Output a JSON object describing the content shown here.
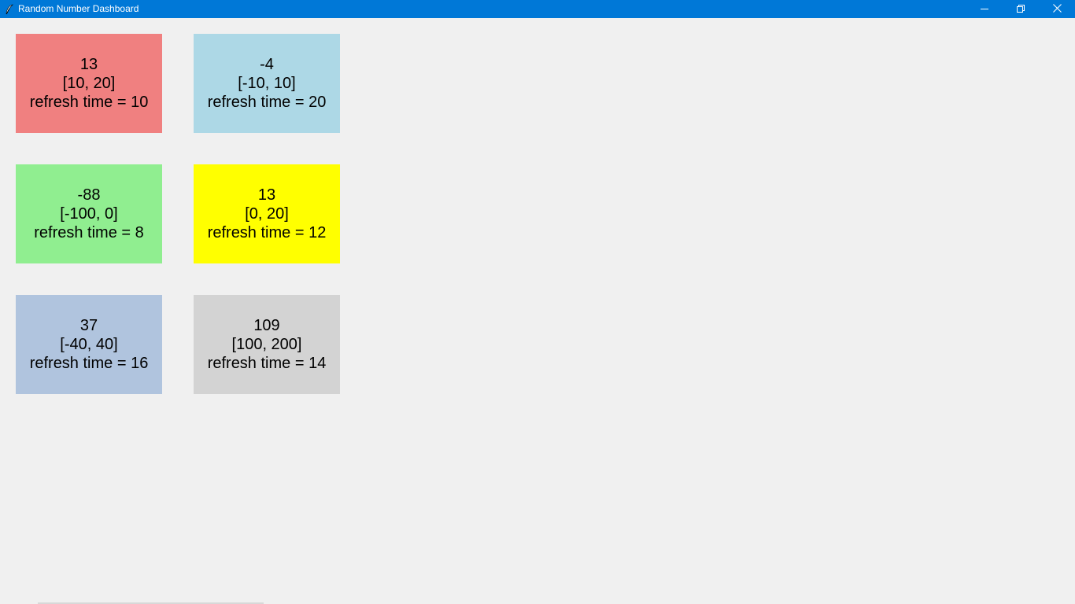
{
  "window": {
    "title": "Random Number Dashboard",
    "controls": [
      "minimize-icon",
      "restore-icon",
      "close-icon"
    ]
  },
  "colors": {
    "titlebar": "#0078d7",
    "background": "#f0f0f0"
  },
  "tiles": [
    {
      "value": "13",
      "range": "[10, 20]",
      "refresh": "refresh time = 10",
      "color": "#f08080"
    },
    {
      "value": "-4",
      "range": "[-10, 10]",
      "refresh": "refresh time = 20",
      "color": "#add8e6"
    },
    {
      "value": "-88",
      "range": "[-100, 0]",
      "refresh": "refresh time = 8",
      "color": "#90ee90"
    },
    {
      "value": "13",
      "range": "[0, 20]",
      "refresh": "refresh time = 12",
      "color": "#ffff00"
    },
    {
      "value": "37",
      "range": "[-40, 40]",
      "refresh": "refresh time = 16",
      "color": "#b0c4de"
    },
    {
      "value": "109",
      "range": "[100, 200]",
      "refresh": "refresh time = 14",
      "color": "#d3d3d3"
    }
  ]
}
